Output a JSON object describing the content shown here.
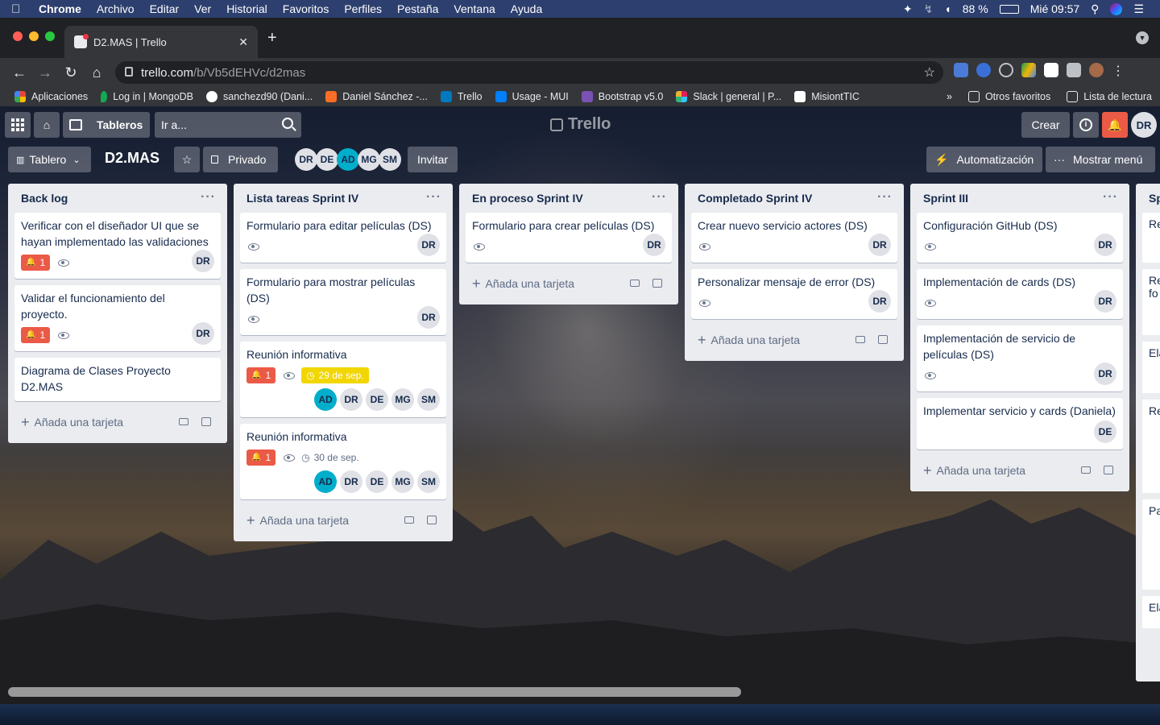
{
  "menubar": {
    "items": [
      "Chrome",
      "Archivo",
      "Editar",
      "Ver",
      "Historial",
      "Favoritos",
      "Perfiles",
      "Pestaña",
      "Ventana",
      "Ayuda"
    ],
    "battery": "88 %",
    "clock": "Mié 09:57"
  },
  "browser": {
    "tab_title": "D2.MAS | Trello",
    "url_host": "trello.com",
    "url_path": "/b/Vb5dEHVc/d2mas",
    "bookmarks": [
      {
        "label": "Aplicaciones",
        "color": "#e94235"
      },
      {
        "label": "Log in | MongoDB",
        "color": "#13aa52"
      },
      {
        "label": "sanchezd90 (Dani...",
        "color": "#ffffff"
      },
      {
        "label": "Daniel Sánchez -...",
        "color": "#fc6d26"
      },
      {
        "label": "Trello",
        "color": "#0079bf"
      },
      {
        "label": "Usage - MUI",
        "color": "#007fff"
      },
      {
        "label": "Bootstrap v5.0",
        "color": "#7952b3"
      },
      {
        "label": "Slack | general | P...",
        "color": "#e01e5a"
      },
      {
        "label": "MisiontTIC",
        "color": "#ffffff"
      }
    ],
    "bookmarks_more": "»",
    "other_favorites": "Otros favoritos",
    "reading_list": "Lista de lectura"
  },
  "header": {
    "boards_label": "Tableros",
    "search_placeholder": "Ir a...",
    "logo": "Trello",
    "create_label": "Crear",
    "user_initials": "DR"
  },
  "board": {
    "view_label": "Tablero",
    "title": "D2.MAS",
    "privacy": "Privado",
    "members": [
      {
        "initials": "DR",
        "color": "#dfe1e6",
        "text": "#172b4d"
      },
      {
        "initials": "DE",
        "color": "#dfe1e6",
        "text": "#172b4d"
      },
      {
        "initials": "AD",
        "color": "#00aecc",
        "text": "#172b4d"
      },
      {
        "initials": "MG",
        "color": "#dfe1e6",
        "text": "#172b4d"
      },
      {
        "initials": "SM",
        "color": "#dfe1e6",
        "text": "#172b4d"
      }
    ],
    "invite_label": "Invitar",
    "automation_label": "Automatización",
    "menu_label": "Mostrar menú"
  },
  "add_card_label": "Añada una tarjeta",
  "lists": [
    {
      "title": "Back log",
      "cards": [
        {
          "title": "Verificar con el diseñador UI que se hayan implementado las validaciones",
          "notif": "1",
          "watch": true,
          "avatars": [
            "DR"
          ]
        },
        {
          "title": "Validar el funcionamiento del proyecto.",
          "notif": "1",
          "watch": true,
          "avatars": [
            "DR"
          ]
        },
        {
          "title": "Diagrama de Clases Proyecto D2.MAS"
        }
      ]
    },
    {
      "title": "Lista tareas Sprint IV",
      "cards": [
        {
          "title": "Formulario para editar películas (DS)",
          "watch": true,
          "avatars": [
            "DR"
          ]
        },
        {
          "title": "Formulario para mostrar películas (DS)",
          "watch": true,
          "avatars": [
            "DR"
          ]
        },
        {
          "title": "Reunión informativa",
          "notif": "1",
          "watch": true,
          "due": "29 de sep.",
          "due_highlight": true,
          "avatars": [
            "AD",
            "DR",
            "DE",
            "MG",
            "SM"
          ]
        },
        {
          "title": "Reunión informativa",
          "notif": "1",
          "watch": true,
          "due": "30 de sep.",
          "avatars": [
            "AD",
            "DR",
            "DE",
            "MG",
            "SM"
          ]
        }
      ]
    },
    {
      "title": "En proceso Sprint IV",
      "cards": [
        {
          "title": "Formulario para crear películas (DS)",
          "watch": true,
          "avatars": [
            "DR"
          ]
        }
      ]
    },
    {
      "title": "Completado Sprint IV",
      "cards": [
        {
          "title": "Crear nuevo servicio actores (DS)",
          "watch": true,
          "avatars": [
            "DR"
          ]
        },
        {
          "title": "Personalizar mensaje de error (DS)",
          "watch": true,
          "avatars": [
            "DR"
          ]
        }
      ]
    },
    {
      "title": "Sprint III",
      "cards": [
        {
          "title": "Configuración GitHub (DS)",
          "watch": true,
          "avatars": [
            "DR"
          ]
        },
        {
          "title": "Implementación de cards (DS)",
          "watch": true,
          "avatars": [
            "DR"
          ]
        },
        {
          "title": "Implementación de servicio de películas (DS)",
          "watch": true,
          "avatars": [
            "DR"
          ]
        },
        {
          "title": "Implementar servicio y cards (Daniela)",
          "avatars": [
            "DE"
          ]
        }
      ]
    }
  ],
  "partial_list": {
    "title": "Sp",
    "cards": [
      "Re",
      "Re fo",
      "Ela",
      "Re",
      "Pa",
      "Ela"
    ]
  }
}
